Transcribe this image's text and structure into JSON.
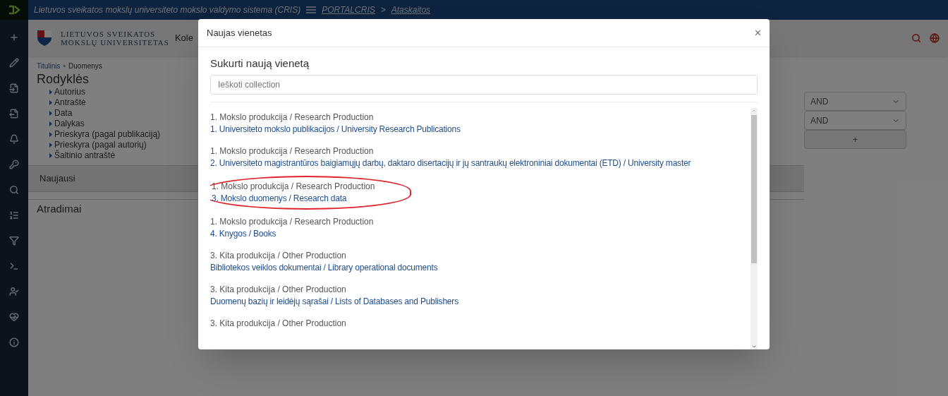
{
  "top_bar": {
    "title": "Lietuvos sveikatos mokslų universiteto mokslo valdymo sistema (CRIS)",
    "links": [
      "PORTALCRIS",
      "Ataskaitos"
    ],
    "separator": ">"
  },
  "header": {
    "logo_lines": [
      "LIETUVOS SVEIKATOS",
      "MOKSLŲ UNIVERSITETAS"
    ],
    "nav_text": "Kole"
  },
  "breadcrumb": [
    "Titulinis",
    "•",
    "Duomenys"
  ],
  "indexes": {
    "title": "Rodyklės",
    "items": [
      "Autorius",
      "Antraštė",
      "Data",
      "Dalykas",
      "Prieskyra (pagal publikaciją)",
      "Prieskyra (pagal autorių)",
      "Šaltinio antraštė"
    ]
  },
  "recent": {
    "title": "Naujausi"
  },
  "discoveries": {
    "title": "Atradimai"
  },
  "search_form": {
    "operators": [
      "AND",
      "AND"
    ],
    "add_button": "+"
  },
  "modal": {
    "title": "Naujas vienetas",
    "close": "×",
    "heading": "Sukurti naują vienetą",
    "search": {
      "placeholder": "Ieškoti collection"
    },
    "collections": [
      {
        "category": "1. Mokslo produkcija / Research Production",
        "title": "1. Universiteto mokslo publikacijos / University Research Publications",
        "circled": false
      },
      {
        "category": "1. Mokslo produkcija / Research Production",
        "title": "2. Universiteto magistrantūros baigiamųjų darbų, daktaro disertacijų ir jų santraukų elektroniniai dokumentai (ETD) / University master",
        "circled": false
      },
      {
        "category": "1. Mokslo produkcija / Research Production",
        "title": "3. Mokslo duomenys / Research data",
        "circled": true
      },
      {
        "category": "1. Mokslo produkcija / Research Production",
        "title": "4. Knygos / Books",
        "circled": false
      },
      {
        "category": "3. Kita produkcija / Other Production",
        "title": "Bibliotekos veiklos dokumentai / Library operational documents",
        "circled": false
      },
      {
        "category": "3. Kita produkcija / Other Production",
        "title": "Duomenų bazių ir leidėjų sąrašai / Lists of Databases and Publishers",
        "circled": false
      },
      {
        "category": "3. Kita produkcija / Other Production",
        "circled": false
      }
    ]
  }
}
